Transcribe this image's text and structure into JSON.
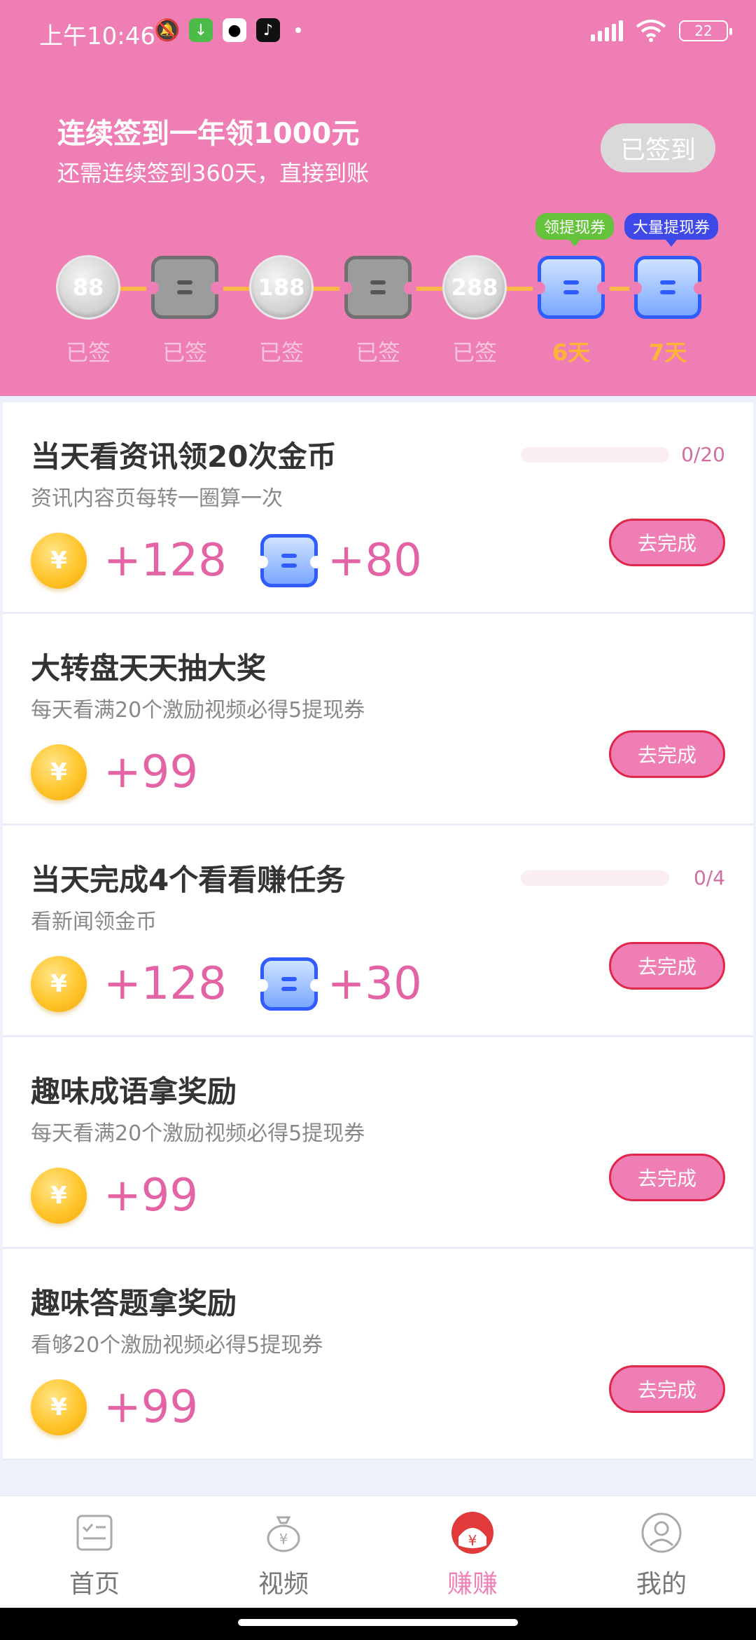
{
  "status": {
    "time": "上午10:46",
    "battery": "22"
  },
  "header": {
    "title": "连续签到一年领1000元",
    "subtitle": "还需连续签到360天，直接到账",
    "signed_button": "已签到",
    "tags": [
      "领提现券",
      "大量提现券"
    ],
    "days": [
      {
        "kind": "coin",
        "value": "88",
        "label": "已签"
      },
      {
        "kind": "ticket",
        "label": "已签"
      },
      {
        "kind": "coin",
        "value": "188",
        "label": "已签"
      },
      {
        "kind": "ticket",
        "label": "已签"
      },
      {
        "kind": "coin",
        "value": "288",
        "label": "已签"
      },
      {
        "kind": "ticket-blue",
        "label": "6天"
      },
      {
        "kind": "ticket-blue",
        "label": "7天"
      }
    ]
  },
  "tasks": [
    {
      "title": "当天看资讯领20次金币",
      "desc": "资讯内容页每转一圈算一次",
      "progress": "0/20",
      "progress_fraction": 0,
      "coin_reward": "+128",
      "ticket_reward": "+80",
      "button": "去完成"
    },
    {
      "title": "大转盘天天抽大奖",
      "desc": "每天看满20个激励视频必得5提现券",
      "coin_reward": "+99",
      "button": "去完成"
    },
    {
      "title": "当天完成4个看看赚任务",
      "desc": "看新闻领金币",
      "progress": "0/4",
      "progress_fraction": 0,
      "coin_reward": "+128",
      "ticket_reward": "+30",
      "button": "去完成"
    },
    {
      "title": "趣味成语拿奖励",
      "desc": "每天看满20个激励视频必得5提现券",
      "coin_reward": "+99",
      "button": "去完成"
    },
    {
      "title": "趣味答题拿奖励",
      "desc": "看够20个激励视频必得5提现券",
      "coin_reward": "+99",
      "button": "去完成"
    }
  ],
  "coin_symbol": "¥",
  "nav": {
    "items": [
      {
        "label": "首页",
        "icon": "home-list-icon"
      },
      {
        "label": "视频",
        "icon": "money-bag-icon"
      },
      {
        "label": "赚赚",
        "icon": "earn-icon",
        "active": true
      },
      {
        "label": "我的",
        "icon": "user-icon"
      }
    ]
  },
  "colors": {
    "accent": "#ef7eb5",
    "gold": "#ffc52b",
    "ticket_blue": "#2f5bff"
  }
}
